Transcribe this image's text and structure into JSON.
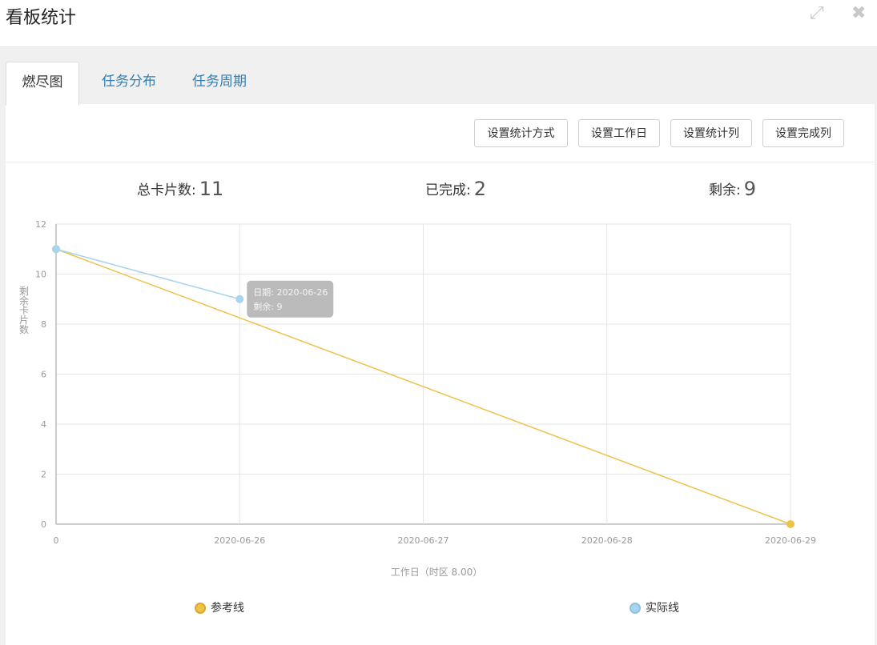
{
  "window": {
    "title": "看板统计",
    "expand_icon": "expand-icon",
    "close_icon": "close-icon"
  },
  "tabs": [
    {
      "label": "燃尽图",
      "active": true
    },
    {
      "label": "任务分布",
      "active": false
    },
    {
      "label": "任务周期",
      "active": false
    }
  ],
  "toolbar": {
    "set_stat_method": "设置统计方式",
    "set_workday": "设置工作日",
    "set_stat_column": "设置统计列",
    "set_done_column": "设置完成列"
  },
  "stats": {
    "total_label": "总卡片数:",
    "total_value": "11",
    "done_label": "已完成:",
    "done_value": "2",
    "remain_label": "剩余:",
    "remain_value": "9"
  },
  "colors": {
    "reference": "#f0c24a",
    "actual": "#a8d4ee",
    "tab_link": "#2f7fb4"
  },
  "chart_data": {
    "type": "line",
    "categories": [
      "0",
      "2020-06-26",
      "2020-06-27",
      "2020-06-28",
      "2020-06-29"
    ],
    "xlabel": "工作日（时区 8.00）",
    "ylabel": "剩余卡片数",
    "ylim": [
      0,
      12
    ],
    "yticks": [
      0,
      2,
      4,
      6,
      8,
      10,
      12
    ],
    "grid": true,
    "legend": "bottom",
    "series": [
      {
        "name": "参考线",
        "x": [
          "0",
          "2020-06-29"
        ],
        "values": [
          11,
          0
        ]
      },
      {
        "name": "实际线",
        "x": [
          "0",
          "2020-06-26"
        ],
        "values": [
          11,
          9
        ]
      }
    ],
    "tooltip": {
      "date_line": "日期: 2020-06-26",
      "remain_line": "剩余: 9"
    }
  }
}
